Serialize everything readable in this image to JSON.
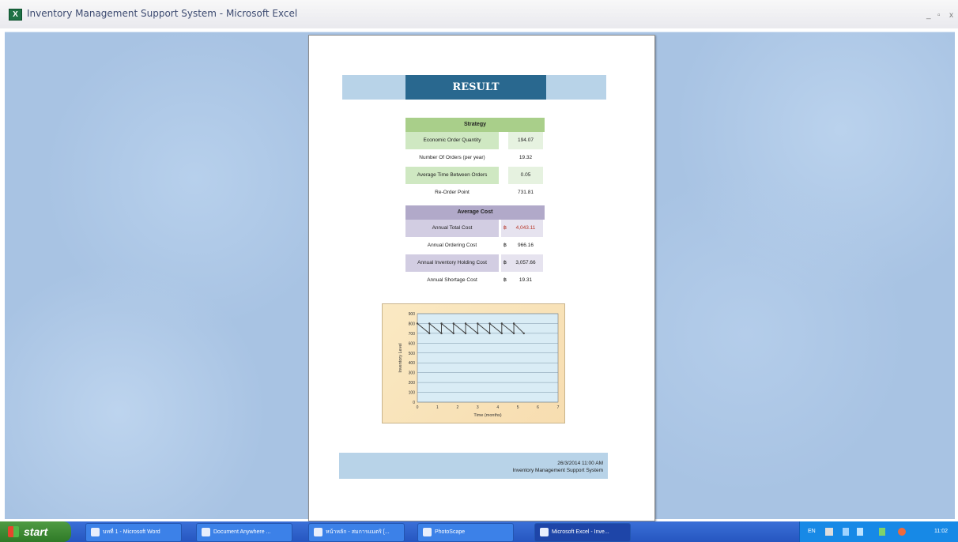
{
  "window": {
    "title": "Inventory Management Support System - Microsoft Excel",
    "minimize": "_",
    "maximize": "▫",
    "close": "x"
  },
  "report": {
    "title": "RESULT",
    "strategy": {
      "header": "Strategy",
      "rows": [
        {
          "label": "Economic Order Quantity",
          "value": "194.07"
        },
        {
          "label": "Number Of Orders (per year)",
          "value": "19.32"
        },
        {
          "label": "Average Time Between Orders",
          "value": "0.05"
        },
        {
          "label": "Re-Order Point",
          "value": "731.81"
        }
      ]
    },
    "cost": {
      "header": "Average Cost",
      "rows": [
        {
          "label": "Annual Total Cost",
          "currency": "฿",
          "value": "4,043.11"
        },
        {
          "label": "Annual Ordering Cost",
          "currency": "฿",
          "value": "966.16"
        },
        {
          "label": "Annual Inventory Holding Cost",
          "currency": "฿",
          "value": "3,057.66"
        },
        {
          "label": "Annual Shortage Cost",
          "currency": "฿",
          "value": "19.31"
        }
      ]
    },
    "footer": {
      "date": "26/3/2014 11:00 AM",
      "system": "Inventory Management Support System"
    }
  },
  "chart_data": {
    "type": "line",
    "title": "",
    "xlabel": "Time (months)",
    "ylabel": "Inventory Level",
    "xlim": [
      0,
      7
    ],
    "ylim": [
      0,
      900
    ],
    "x_ticks": [
      "0",
      "1",
      "2",
      "3",
      "4",
      "5",
      "6",
      "7"
    ],
    "y_ticks": [
      "0",
      "100",
      "200",
      "300",
      "400",
      "500",
      "600",
      "700",
      "800",
      "900"
    ],
    "series": [
      {
        "values": [
          {
            "x": 0,
            "y": 800
          },
          {
            "x": 0.6,
            "y": 700
          },
          {
            "x": 0.6,
            "y": 800
          },
          {
            "x": 1.2,
            "y": 700
          },
          {
            "x": 1.2,
            "y": 800
          },
          {
            "x": 1.8,
            "y": 700
          },
          {
            "x": 1.8,
            "y": 800
          },
          {
            "x": 2.4,
            "y": 700
          },
          {
            "x": 2.4,
            "y": 800
          },
          {
            "x": 3.0,
            "y": 700
          },
          {
            "x": 3.0,
            "y": 800
          },
          {
            "x": 3.6,
            "y": 700
          },
          {
            "x": 3.6,
            "y": 800
          },
          {
            "x": 4.2,
            "y": 700
          },
          {
            "x": 4.2,
            "y": 800
          },
          {
            "x": 4.8,
            "y": 700
          },
          {
            "x": 4.8,
            "y": 800
          },
          {
            "x": 5.3,
            "y": 700
          }
        ]
      }
    ],
    "grid": true,
    "background": "#d9ecf5",
    "line_color": "#444444"
  },
  "taskbar": {
    "start": "start",
    "tasks": [
      "บทที่ 1 - Microsoft Word",
      "Document Anywhere ...",
      "หน้าหลัก - สมการแมตริ [...",
      "PhotoScape",
      "Microsoft Excel - Inve..."
    ],
    "tray_lang": "EN",
    "clock": "11:02"
  }
}
